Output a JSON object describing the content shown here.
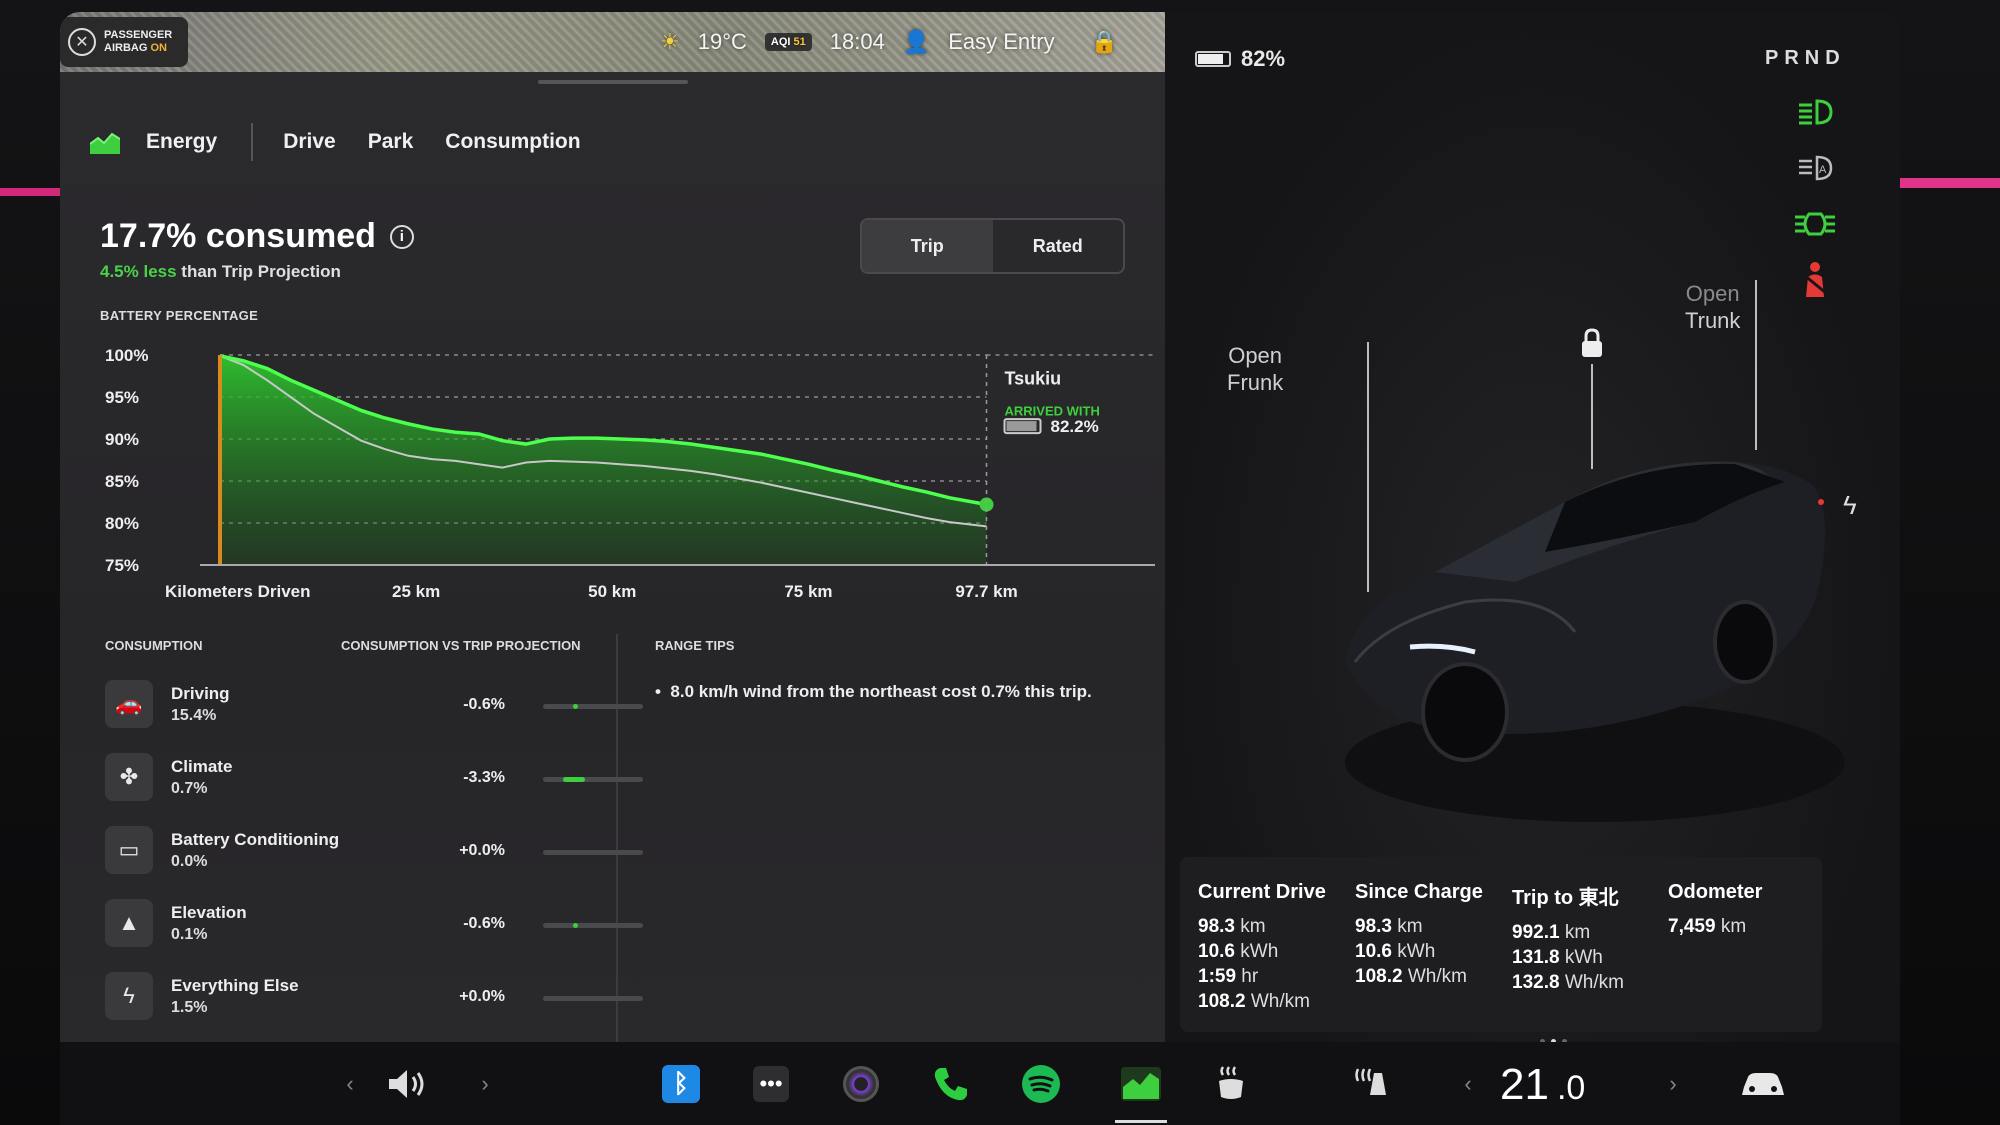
{
  "status_bar": {
    "airbag_line1": "PASSENGER",
    "airbag_line2_prefix": "AIRBAG ",
    "airbag_state": "ON",
    "temperature": "19°C",
    "aqi_label": "AQI",
    "aqi_value": "51",
    "time": "18:04",
    "profile": "Easy Entry"
  },
  "tabs": [
    "Energy",
    "Drive",
    "Park",
    "Consumption"
  ],
  "headline": {
    "consumed": "17.7% consumed",
    "less_value": "4.5% less",
    "less_suffix": " than Trip Projection"
  },
  "toggle": {
    "trip": "Trip",
    "rated": "Rated",
    "selected": "Trip"
  },
  "chart_data": {
    "type": "line",
    "title": "BATTERY PERCENTAGE",
    "xlabel": "Kilometers Driven",
    "x_ticks": [
      "25 km",
      "50 km",
      "75 km",
      "97.7 km"
    ],
    "x_tick_values": [
      25,
      50,
      75,
      97.7
    ],
    "y_ticks": [
      "100%",
      "95%",
      "90%",
      "85%",
      "80%",
      "75%"
    ],
    "y_tick_values": [
      100,
      95,
      90,
      85,
      80,
      75
    ],
    "xlim": [
      0,
      123
    ],
    "ylim": [
      75,
      100
    ],
    "destination": "Tsukiu",
    "arrived_label": "ARRIVED WITH",
    "arrived_value": "82.2%",
    "series": [
      {
        "x": [
          0,
          3,
          6,
          9,
          12,
          15,
          18,
          21,
          24,
          27,
          30,
          33,
          36,
          39,
          42,
          45,
          48,
          51,
          54,
          57,
          60,
          63,
          66,
          69,
          72,
          75,
          78,
          81,
          84,
          87,
          90,
          93,
          97.7
        ],
        "values": [
          99.9,
          99.3,
          98.4,
          97.0,
          95.8,
          94.6,
          93.4,
          92.5,
          91.8,
          91.2,
          90.8,
          90.6,
          89.8,
          89.4,
          90.0,
          90.1,
          90.1,
          90.0,
          89.9,
          89.7,
          89.4,
          89.0,
          88.6,
          88.2,
          87.6,
          87.0,
          86.3,
          85.7,
          85.0,
          84.3,
          83.7,
          83.0,
          82.2
        ]
      },
      {
        "x": [
          0,
          3,
          6,
          9,
          12,
          15,
          18,
          21,
          24,
          27,
          30,
          33,
          36,
          39,
          42,
          45,
          48,
          51,
          54,
          57,
          60,
          63,
          66,
          69,
          72,
          75,
          78,
          81,
          84,
          87,
          90,
          93,
          97.7
        ],
        "values": [
          99.9,
          98.8,
          97.0,
          95.0,
          93.0,
          91.4,
          89.8,
          88.8,
          88.0,
          87.6,
          87.4,
          87.0,
          86.6,
          87.2,
          87.4,
          87.3,
          87.2,
          87.0,
          86.8,
          86.5,
          86.2,
          85.8,
          85.3,
          84.8,
          84.2,
          83.6,
          83.0,
          82.4,
          81.8,
          81.2,
          80.6,
          80.1,
          79.6
        ]
      }
    ]
  },
  "consumption": {
    "col1": "CONSUMPTION",
    "col2": "CONSUMPTION VS TRIP PROJECTION",
    "col3": "RANGE TIPS",
    "rows": [
      {
        "name": "Driving",
        "value": "15.4%",
        "delta": "-0.6%",
        "bar": 0.04,
        "icon": "car-icon"
      },
      {
        "name": "Climate",
        "value": "0.7%",
        "delta": "-3.3%",
        "bar": 0.22,
        "icon": "fan-icon"
      },
      {
        "name": "Battery Conditioning",
        "value": "0.0%",
        "delta": "+0.0%",
        "bar": 0,
        "icon": "battery-icon"
      },
      {
        "name": "Elevation",
        "value": "0.1%",
        "delta": "-0.6%",
        "bar": 0.04,
        "icon": "mountain-icon"
      },
      {
        "name": "Everything Else",
        "value": "1.5%",
        "delta": "+0.0%",
        "bar": 0,
        "icon": "bolt-icon"
      }
    ],
    "tip": "8.0 km/h wind from the northeast cost 0.7% this trip."
  },
  "vehicle": {
    "battery": "82%",
    "battery_level": 0.82,
    "gear": "PRND",
    "frunk_line1": "Open",
    "frunk_line2": "Frunk",
    "trunk_line1": "Open",
    "trunk_line2": "Trunk"
  },
  "stats": [
    {
      "title": "Current Drive",
      "lines": [
        [
          "98.3",
          " km"
        ],
        [
          "10.6",
          " kWh"
        ],
        [
          "1:59",
          " hr"
        ],
        [
          "108.2",
          " Wh/km"
        ]
      ]
    },
    {
      "title": "Since Charge",
      "lines": [
        [
          "98.3",
          " km"
        ],
        [
          "10.6",
          " kWh"
        ],
        [
          "108.2",
          " Wh/km"
        ]
      ]
    },
    {
      "title": "Trip to 東北",
      "lines": [
        [
          "992.1",
          " km"
        ],
        [
          "131.8",
          " kWh"
        ],
        [
          "132.8",
          " Wh/km"
        ]
      ]
    },
    {
      "title": "Odometer",
      "lines": [
        [
          "7,459",
          " km"
        ]
      ]
    }
  ],
  "dock": {
    "temp_int": "21",
    "temp_dec": ".0"
  },
  "colors": {
    "accent_green": "#3ecf3e",
    "projection_line": "#bdbdbd",
    "bluetooth": "#1e88e5",
    "spotify": "#1db954",
    "phone": "#2ecc40"
  }
}
